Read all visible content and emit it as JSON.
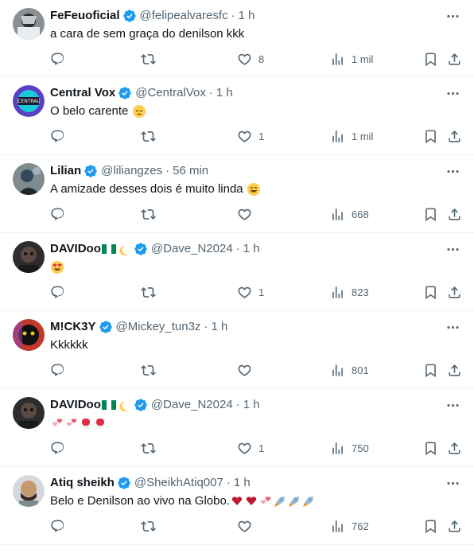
{
  "colors": {
    "text": "#0f1419",
    "muted": "#536471",
    "verified": "#1d9bf0",
    "border": "#eff3f4"
  },
  "tweets": [
    {
      "name": "FeFeuoficial",
      "handle": "@felipealvaresfc",
      "time": "1 h",
      "text": "a cara de  sem graça do denilson kkk",
      "likes": "8",
      "views": "1 mil",
      "emoji": ""
    },
    {
      "name": "Central Vox",
      "handle": "@CentralVox",
      "time": "1 h",
      "text": "O belo carente",
      "likes": "1",
      "views": "1 mil",
      "emoji": "pensive-face"
    },
    {
      "name": "Lilian",
      "handle": "@liliangzes",
      "time": "56 min",
      "text": "A amizade desses dois é muito linda",
      "likes": "",
      "views": "668",
      "emoji": "smiling-face"
    },
    {
      "name": "DAVIDoo",
      "handle": "@Dave_N2024",
      "time": "1 h",
      "text": "",
      "likes": "1",
      "views": "823",
      "emoji": "heart-eyes-face"
    },
    {
      "name": "M!CK3Y",
      "handle": "@Mickey_tun3z",
      "time": "1 h",
      "text": "Kkkkkk",
      "likes": "",
      "views": "801",
      "emoji": ""
    },
    {
      "name": "DAVIDoo",
      "handle": "@Dave_N2024",
      "time": "1 h",
      "text": "",
      "likes": "1",
      "views": "750",
      "emoji": "hearts-and-boxing-gloves"
    },
    {
      "name": "Atiq sheikh",
      "handle": "@SheikhAtiq007",
      "time": "1 h",
      "text": "Belo e Denilson ao vivo na Globo.",
      "likes": "",
      "views": "762",
      "emoji": "hearts-and-rockets"
    }
  ],
  "separator": "·"
}
